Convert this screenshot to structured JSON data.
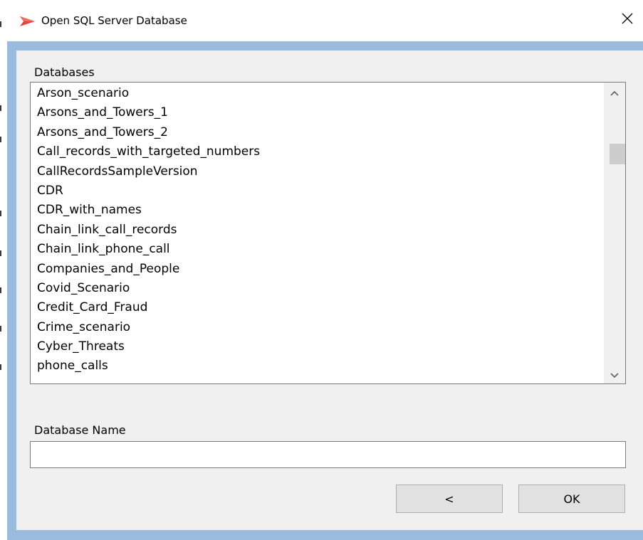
{
  "window": {
    "title": "Open SQL Server Database",
    "icon": "app-flag-icon",
    "close_icon": "close-icon"
  },
  "databases": {
    "label": "Databases",
    "items": [
      "Arson_scenario",
      "Arsons_and_Towers_1",
      "Arsons_and_Towers_2",
      "Call_records_with_targeted_numbers",
      "CallRecordsSampleVersion",
      "CDR",
      "CDR_with_names",
      "Chain_link_call_records",
      "Chain_link_phone_call",
      "Companies_and_People",
      "Covid_Scenario",
      "Credit_Card_Fraud",
      "Crime_scenario",
      "Cyber_Threats",
      "phone_calls"
    ]
  },
  "database_name": {
    "label": "Database Name",
    "value": "",
    "placeholder": ""
  },
  "buttons": {
    "back_label": "<",
    "ok_label": "OK"
  },
  "colors": {
    "frame": "#9bbbdc",
    "client": "#f0f0f0",
    "button": "#e1e1e1",
    "icon_red": "#e8423a"
  }
}
